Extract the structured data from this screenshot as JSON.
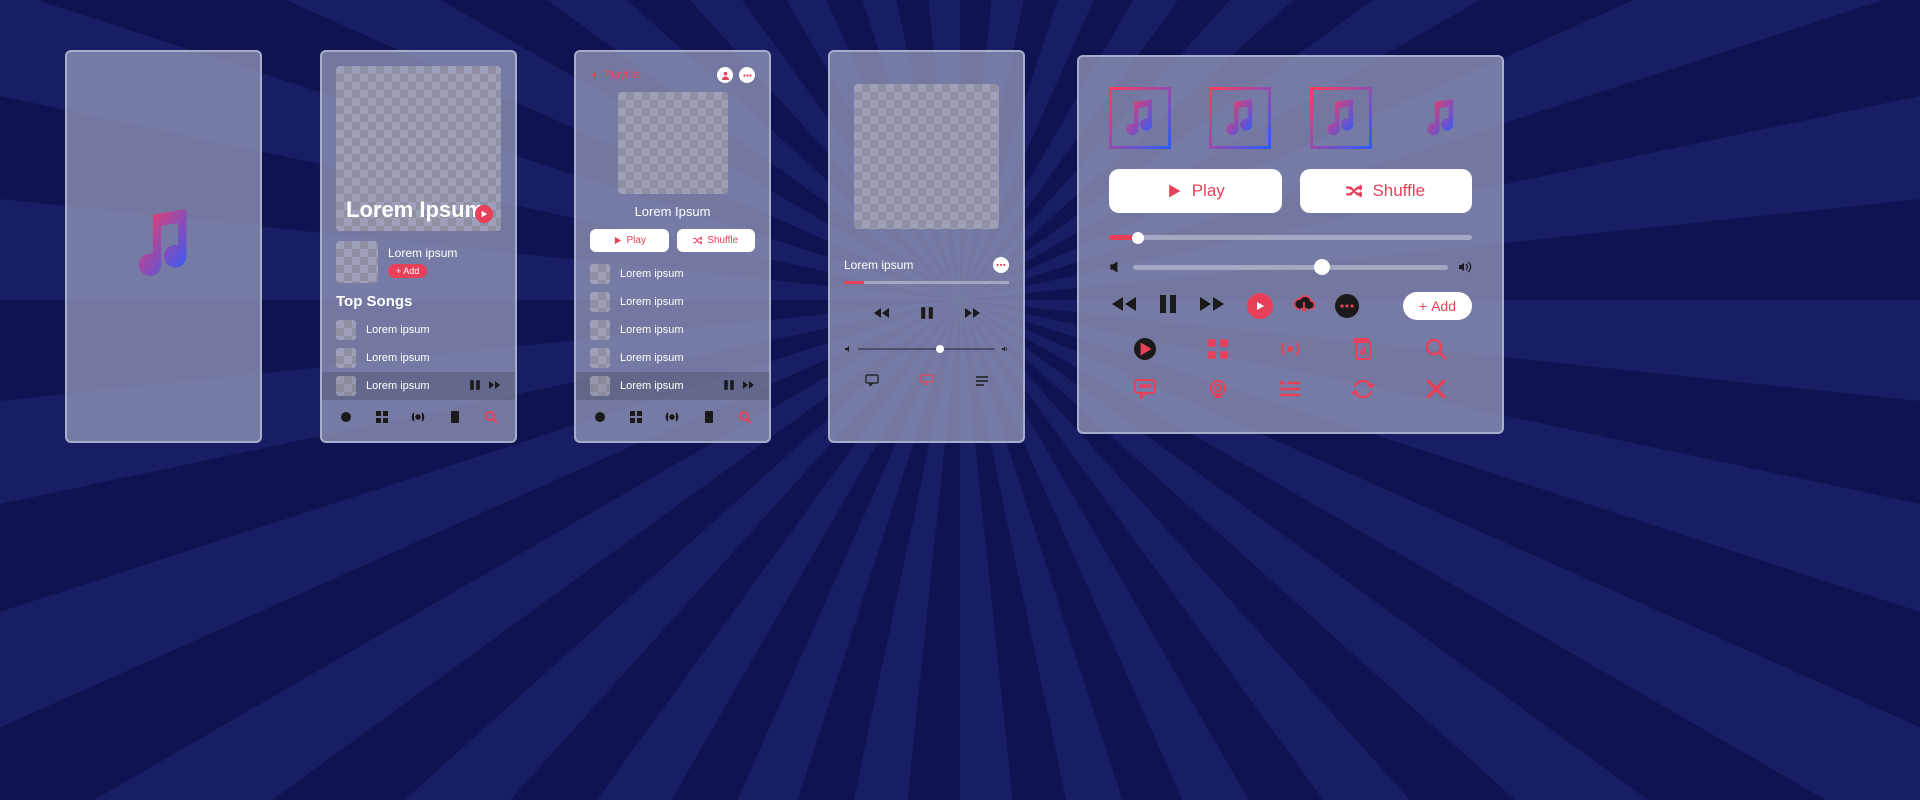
{
  "panel2": {
    "hero_title": "Lorem Ipsum",
    "artist_name": "Lorem ipsum",
    "add_label": "+ Add",
    "section": "Top Songs",
    "songs": [
      "Lorem ipsum",
      "Lorem ipsum",
      "Lorem ipsum"
    ]
  },
  "panel3": {
    "back_label": "Playlist",
    "title": "Lorem Ipsum",
    "play": "Play",
    "shuffle": "Shuffle",
    "songs": [
      "Lorem ipsum",
      "Lorem ipsum",
      "Lorem ipsum",
      "Lorem ipsum",
      "Lorem ipsum"
    ]
  },
  "panel4": {
    "title": "Lorem ipsum",
    "progress_pct": 12
  },
  "panel5": {
    "play": "Play",
    "shuffle": "Shuffle",
    "add": "Add",
    "progress_pct": 8,
    "volume_pct": 60
  }
}
